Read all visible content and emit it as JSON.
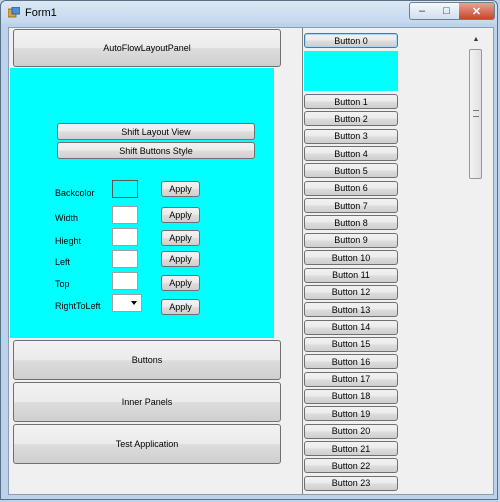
{
  "window": {
    "title": "Form1",
    "controls": {
      "minimize": "–",
      "maximize": "□",
      "close": "✕"
    }
  },
  "left": {
    "autoflow_button": "AutoFlowLayoutPanel",
    "shift_layout_button": "Shift Layout View",
    "shift_buttons_button": "Shift Buttons Style",
    "props": [
      {
        "label": "Backcolor",
        "apply": "Apply"
      },
      {
        "label": "Width",
        "apply": "Apply"
      },
      {
        "label": "Hieght",
        "apply": "Apply"
      },
      {
        "label": "Left",
        "apply": "Apply"
      },
      {
        "label": "Top",
        "apply": "Apply"
      },
      {
        "label": "RightToLeft",
        "apply": "Apply"
      }
    ],
    "bottom_buttons": [
      "Buttons",
      "Inner Panels",
      "Test Application"
    ]
  },
  "right": {
    "buttons": [
      "Button 0",
      "Button 1",
      "Button 2",
      "Button 3",
      "Button 4",
      "Button 5",
      "Button 6",
      "Button 7",
      "Button 8",
      "Button 9",
      "Button 10",
      "Button 11",
      "Button 12",
      "Button 13",
      "Button 14",
      "Button 15",
      "Button 16",
      "Button 17",
      "Button 18",
      "Button 19",
      "Button 20",
      "Button 21",
      "Button 22",
      "Button 23"
    ]
  },
  "colors": {
    "cyan": "#00ffff"
  },
  "icons": {
    "app": "form-app-icon",
    "scroll_up": "scroll-up-arrow-icon",
    "scroll_down": "scroll-down-arrow-icon"
  }
}
